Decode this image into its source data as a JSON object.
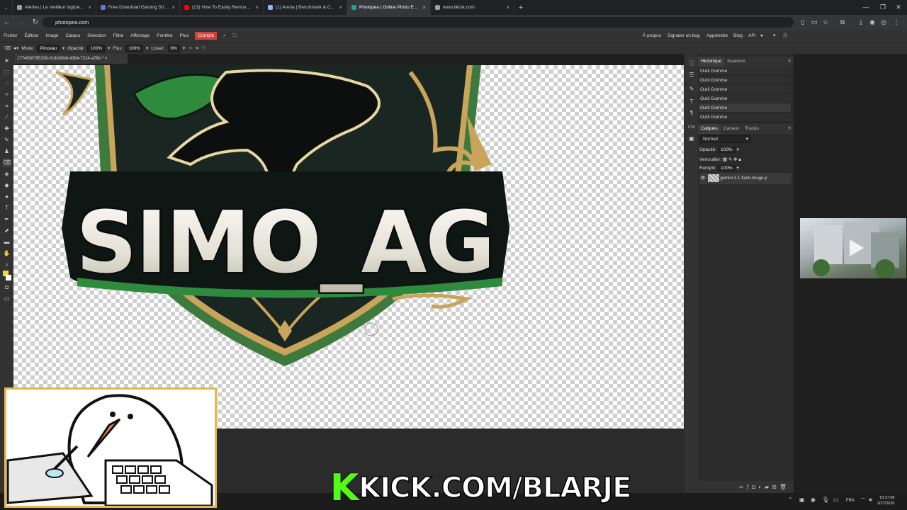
{
  "browser": {
    "tabs": [
      {
        "label": "Alertes | Le meilleur logiciel po",
        "color": "#9aa0a6"
      },
      {
        "label": "Free Download Gaming Stream",
        "color": "#5a7bd6"
      },
      {
        "label": "(13) How To Easily Remove A W",
        "color": "#ff0000"
      },
      {
        "label": "(1) Arena | Benchmark & Comp",
        "color": "#8ab4f8"
      },
      {
        "label": "Photopea | Online Photo Editor",
        "color": "#18a497",
        "active": true
      },
      {
        "label": "www.tiktok.com",
        "color": "#9aa0a6"
      }
    ],
    "url": "photopea.com"
  },
  "menubar": {
    "items": [
      "Fichier",
      "Édition",
      "Image",
      "Calque",
      "Sélection",
      "Filtre",
      "Affichage",
      "Fenêtre",
      "Plus"
    ],
    "account": "Compte",
    "right": [
      "À propos",
      "Signaler un bug",
      "Apprendre",
      "Blog",
      "API"
    ]
  },
  "options": {
    "mode_label": "Mode:",
    "mode_value": "Pinceau",
    "opacity_label": "Opacité:",
    "opacity_value": "100%",
    "flow_label": "Flux:",
    "flow_value": "100%",
    "smooth_label": "Lisser:",
    "smooth_value": "0%"
  },
  "document": {
    "tab_label": "177463879533­9-019d30b6-4384-7224-a78b",
    "logo_text": "SIMO_AG"
  },
  "panels": {
    "top_tabs": [
      "Historique",
      "Nuancier"
    ],
    "history": [
      "Outil Gomme",
      "Outil Gomme",
      "Outil Gomme",
      "Outil Gomme",
      "Outil Gomme",
      "Outil Gomme"
    ],
    "layer_tabs": [
      "Calques",
      "Canaux",
      "Tracés"
    ],
    "blend_mode": "Normal",
    "opacity_label": "Opacité:",
    "opacity_value": "100%",
    "lock_label": "Verrouiller:",
    "fill_label": "Remplir:",
    "fill_value": "100%",
    "layer_name": "gemini-3.1-flash-image-p"
  },
  "overlay": {
    "kick_k": "K",
    "kick_text": "KICK.COM/BLARJE"
  },
  "taskbar": {
    "lang": "FRA",
    "time": "19:27:08",
    "date": "3/27/2026"
  },
  "colors": {
    "accent": "#d2423d",
    "kick_green": "#53fc18",
    "shield_green": "#2e8b3e",
    "gold": "#c9a55b"
  }
}
